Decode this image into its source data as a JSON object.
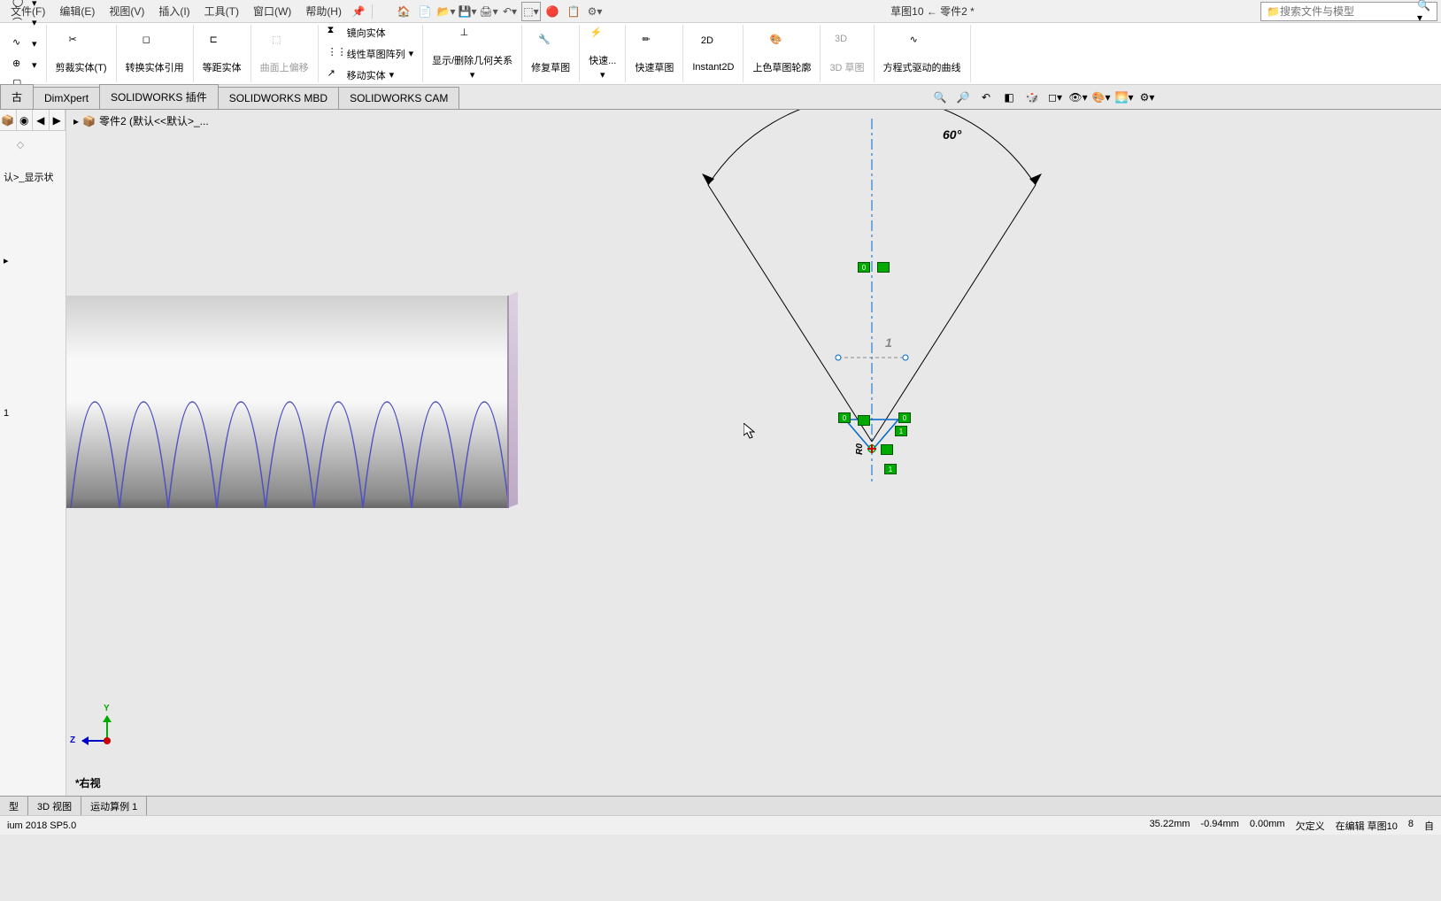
{
  "menu": {
    "file": "文件(F)",
    "edit": "编辑(E)",
    "view": "视图(V)",
    "insert": "插入(I)",
    "tools": "工具(T)",
    "window": "窗口(W)",
    "help": "帮助(H)"
  },
  "doc_title": "草图10 ← 零件2 *",
  "search": {
    "placeholder": "搜索文件与模型"
  },
  "ribbon": {
    "trim": "剪裁实体(T)",
    "convert": "转换实体引用",
    "offset": "等距实体",
    "onsurf": "曲面上偏移",
    "mirror": "镜向实体",
    "linear_pattern": "线性草图阵列",
    "move": "移动实体",
    "display_rel": "显示/删除几何关系",
    "repair": "修复草图",
    "quick": "快速...",
    "rapid": "快速草图",
    "instant2d": "Instant2D",
    "shaded": "上色草图轮廓",
    "sketch3d": "3D 草图",
    "equation": "方程式驱动的曲线"
  },
  "tabs": {
    "t1": "古",
    "dimxpert": "DimXpert",
    "plugins": "SOLIDWORKS 插件",
    "mbd": "SOLIDWORKS MBD",
    "cam": "SOLIDWORKS CAM"
  },
  "tree": {
    "root": "零件2 (默认<<默认>_...",
    "display_state": "认>_显示状",
    "item1": "1"
  },
  "sketch": {
    "angle_dim": "60°",
    "dim_1": "1",
    "rel_h0": "0",
    "rel_v": "",
    "rel_0a": "0",
    "rel_0b": "0",
    "rel_1a": "1",
    "rel_1b": "1",
    "radius": "R0"
  },
  "view_name": "*右视",
  "triad": {
    "y": "Y",
    "z": "Z"
  },
  "bottom_tabs": {
    "t1": "型",
    "t2": "3D 视图",
    "t3": "运动算例 1"
  },
  "status": {
    "version": "ium 2018 SP5.0",
    "x": "35.22mm",
    "y": "-0.94mm",
    "z": "0.00mm",
    "underdefined": "欠定义",
    "editing": "在编辑 草图10",
    "count": "8",
    "auto": "自"
  }
}
